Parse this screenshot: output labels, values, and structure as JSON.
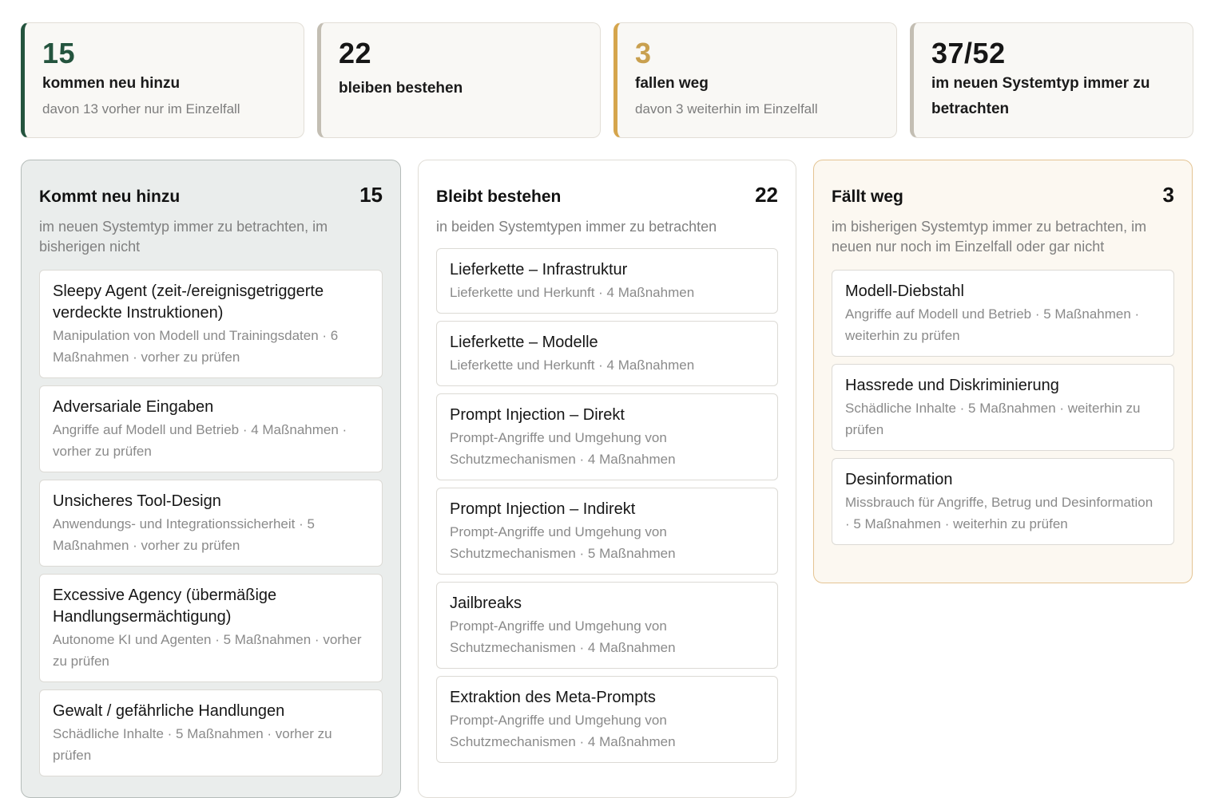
{
  "stats": [
    {
      "number": "15",
      "label": "kommen neu hinzu",
      "sub": "davon 13 vorher nur im Einzelfall"
    },
    {
      "number": "22",
      "label": "bleiben bestehen",
      "sub": ""
    },
    {
      "number": "3",
      "label": "fallen weg",
      "sub": "davon 3 weiterhin im Einzelfall"
    },
    {
      "number": "37/52",
      "label": "im neuen Systemtyp immer zu betrachten",
      "sub": ""
    }
  ],
  "colors": {
    "accent_green": "#24543e",
    "accent_gold": "#d5a54c",
    "accent_neutral": "#c3beb3"
  },
  "columns": [
    {
      "title": "Kommt neu hinzu",
      "count": "15",
      "description": "im neuen Systemtyp immer zu betrachten, im bisherigen nicht",
      "items": [
        {
          "title": "Sleepy Agent (zeit-/ereignisgetriggerte verdeckte Instruktionen)",
          "meta": "Manipulation von Modell und Trainingsdaten · 6 Maßnahmen · vorher zu prüfen"
        },
        {
          "title": "Adversariale Eingaben",
          "meta": "Angriffe auf Modell und Betrieb · 4 Maßnahmen · vorher zu prüfen"
        },
        {
          "title": "Unsicheres Tool-Design",
          "meta": "Anwendungs- und Integrationssicherheit · 5 Maßnahmen · vorher zu prüfen"
        },
        {
          "title": "Excessive Agency (übermäßige Handlungsermächtigung)",
          "meta": "Autonome KI und Agenten · 5 Maßnahmen · vorher zu prüfen"
        },
        {
          "title": "Gewalt / gefährliche Handlungen",
          "meta": "Schädliche Inhalte · 5 Maßnahmen · vorher zu prüfen"
        }
      ]
    },
    {
      "title": "Bleibt bestehen",
      "count": "22",
      "description": "in beiden Systemtypen immer zu betrachten",
      "items": [
        {
          "title": "Lieferkette – Infrastruktur",
          "meta": "Lieferkette und Herkunft · 4 Maßnahmen"
        },
        {
          "title": "Lieferkette – Modelle",
          "meta": "Lieferkette und Herkunft · 4 Maßnahmen"
        },
        {
          "title": "Prompt Injection – Direkt",
          "meta": "Prompt-Angriffe und Umgehung von Schutzmechanismen · 4 Maßnahmen"
        },
        {
          "title": "Prompt Injection – Indirekt",
          "meta": "Prompt-Angriffe und Umgehung von Schutzmechanismen · 5 Maßnahmen"
        },
        {
          "title": "Jailbreaks",
          "meta": "Prompt-Angriffe und Umgehung von Schutzmechanismen · 4 Maßnahmen"
        },
        {
          "title": "Extraktion des Meta-Prompts",
          "meta": "Prompt-Angriffe und Umgehung von Schutzmechanismen · 4 Maßnahmen"
        }
      ]
    },
    {
      "title": "Fällt weg",
      "count": "3",
      "description": "im bisherigen Systemtyp immer zu betrachten, im neuen nur noch im Einzelfall oder gar nicht",
      "items": [
        {
          "title": "Modell-Diebstahl",
          "meta": "Angriffe auf Modell und Betrieb · 5 Maßnahmen · weiterhin zu prüfen"
        },
        {
          "title": "Hassrede und Diskriminierung",
          "meta": "Schädliche Inhalte · 5 Maßnahmen · weiterhin zu prüfen"
        },
        {
          "title": "Desinformation",
          "meta": "Missbrauch für Angriffe, Betrug und Desinformation · 5 Maßnahmen · weiterhin zu prüfen"
        }
      ]
    }
  ]
}
